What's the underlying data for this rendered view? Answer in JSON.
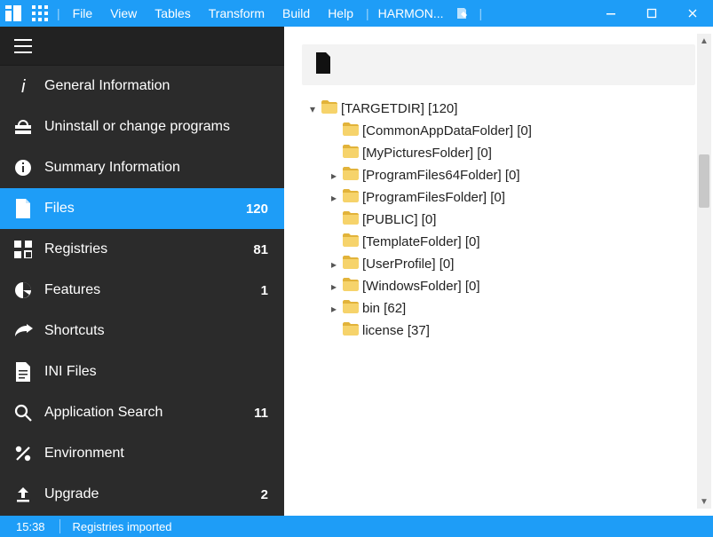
{
  "titlebar": {
    "menus": [
      "File",
      "View",
      "Tables",
      "Transform",
      "Build",
      "Help"
    ],
    "document": "HARMON..."
  },
  "sidebar": {
    "items": [
      {
        "icon": "info-italic",
        "label": "General Information",
        "badge": ""
      },
      {
        "icon": "uninstall",
        "label": "Uninstall or change programs",
        "badge": ""
      },
      {
        "icon": "info-circle",
        "label": "Summary Information",
        "badge": ""
      },
      {
        "icon": "file",
        "label": "Files",
        "badge": "120",
        "selected": true
      },
      {
        "icon": "registry",
        "label": "Registries",
        "badge": "81"
      },
      {
        "icon": "pie",
        "label": "Features",
        "badge": "1"
      },
      {
        "icon": "shortcut",
        "label": "Shortcuts",
        "badge": ""
      },
      {
        "icon": "inifile",
        "label": "INI Files",
        "badge": ""
      },
      {
        "icon": "search",
        "label": "Application Search",
        "badge": "11"
      },
      {
        "icon": "percent",
        "label": "Environment",
        "badge": ""
      },
      {
        "icon": "upgrade",
        "label": "Upgrade",
        "badge": "2"
      }
    ]
  },
  "tree": {
    "nodes": [
      {
        "depth": 0,
        "caret": "down",
        "label": "[TARGETDIR] [120]"
      },
      {
        "depth": 1,
        "caret": "",
        "label": "[CommonAppDataFolder] [0]"
      },
      {
        "depth": 1,
        "caret": "",
        "label": "[MyPicturesFolder] [0]"
      },
      {
        "depth": 1,
        "caret": "right",
        "label": "[ProgramFiles64Folder] [0]"
      },
      {
        "depth": 1,
        "caret": "right",
        "label": "[ProgramFilesFolder] [0]"
      },
      {
        "depth": 1,
        "caret": "",
        "label": "[PUBLIC] [0]"
      },
      {
        "depth": 1,
        "caret": "",
        "label": "[TemplateFolder] [0]"
      },
      {
        "depth": 1,
        "caret": "right",
        "label": "[UserProfile] [0]"
      },
      {
        "depth": 1,
        "caret": "right",
        "label": "[WindowsFolder] [0]"
      },
      {
        "depth": 1,
        "caret": "right",
        "label": "bin [62]"
      },
      {
        "depth": 1,
        "caret": "",
        "label": "license [37]"
      }
    ]
  },
  "status": {
    "time": "15:38",
    "message": "Registries imported"
  },
  "colors": {
    "accent": "#1e9df7"
  }
}
